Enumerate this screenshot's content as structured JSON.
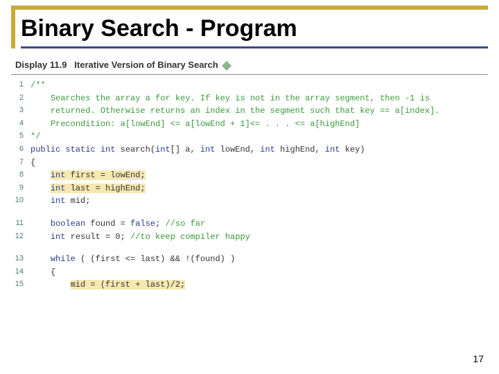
{
  "slide": {
    "title": "Binary Search - Program",
    "display_label": "Display 11.9",
    "display_title": "Iterative Version of Binary Search",
    "page_number": "17"
  },
  "code": {
    "lines": [
      {
        "n": "1",
        "ind": 0,
        "segs": [
          {
            "t": "/**",
            "cls": "cmt"
          }
        ]
      },
      {
        "n": "2",
        "ind": 1,
        "segs": [
          {
            "t": "Searches the array a for key. If key is not in the array segment, then -1 is",
            "cls": "cmt"
          }
        ]
      },
      {
        "n": "3",
        "ind": 1,
        "segs": [
          {
            "t": "returned. Otherwise returns an index in the segment such that key == a[index].",
            "cls": "cmt"
          }
        ]
      },
      {
        "n": "4",
        "ind": 1,
        "segs": [
          {
            "t": "Precondition: a[lowEnd] <= a[lowEnd + 1]<= . . . <= a[highEnd]",
            "cls": "cmt"
          }
        ]
      },
      {
        "n": "5",
        "ind": 0,
        "segs": [
          {
            "t": "*/",
            "cls": "cmt"
          }
        ]
      },
      {
        "n": "6",
        "ind": 0,
        "segs": [
          {
            "t": "public static int",
            "cls": "kw"
          },
          {
            "t": " search(",
            "cls": ""
          },
          {
            "t": "int",
            "cls": "kw"
          },
          {
            "t": "[] a, ",
            "cls": ""
          },
          {
            "t": "int",
            "cls": "kw"
          },
          {
            "t": " lowEnd, ",
            "cls": ""
          },
          {
            "t": "int",
            "cls": "kw"
          },
          {
            "t": " highEnd, ",
            "cls": ""
          },
          {
            "t": "int",
            "cls": "kw"
          },
          {
            "t": " key)",
            "cls": ""
          }
        ]
      },
      {
        "n": "7",
        "ind": 0,
        "segs": [
          {
            "t": "{",
            "cls": ""
          }
        ]
      },
      {
        "n": "8",
        "ind": 1,
        "segs": [
          {
            "t": "int",
            "cls": "kw hl"
          },
          {
            "t": " first = lowEnd;",
            "cls": "hl"
          }
        ]
      },
      {
        "n": "9",
        "ind": 1,
        "segs": [
          {
            "t": "int",
            "cls": "kw hl"
          },
          {
            "t": " last = highEnd;",
            "cls": "hl"
          }
        ]
      },
      {
        "n": "10",
        "ind": 1,
        "segs": [
          {
            "t": "int",
            "cls": "kw"
          },
          {
            "t": " mid;",
            "cls": ""
          }
        ]
      },
      {
        "blank": true
      },
      {
        "n": "11",
        "ind": 1,
        "segs": [
          {
            "t": "boolean",
            "cls": "kw"
          },
          {
            "t": " found = ",
            "cls": ""
          },
          {
            "t": "false",
            "cls": "kw"
          },
          {
            "t": "; ",
            "cls": ""
          },
          {
            "t": "//so far",
            "cls": "cmt"
          }
        ]
      },
      {
        "n": "12",
        "ind": 1,
        "segs": [
          {
            "t": "int",
            "cls": "kw"
          },
          {
            "t": " result = 0; ",
            "cls": ""
          },
          {
            "t": "//to keep compiler happy",
            "cls": "cmt"
          }
        ]
      },
      {
        "blank": true
      },
      {
        "n": "13",
        "ind": 1,
        "segs": [
          {
            "t": "while",
            "cls": "kw"
          },
          {
            "t": " ( (first <= last) && !(found) )",
            "cls": ""
          }
        ]
      },
      {
        "n": "14",
        "ind": 1,
        "segs": [
          {
            "t": "{",
            "cls": ""
          }
        ]
      },
      {
        "n": "15",
        "ind": 2,
        "segs": [
          {
            "t": "mid = (first + last)/2;",
            "cls": "hl"
          }
        ]
      }
    ]
  }
}
